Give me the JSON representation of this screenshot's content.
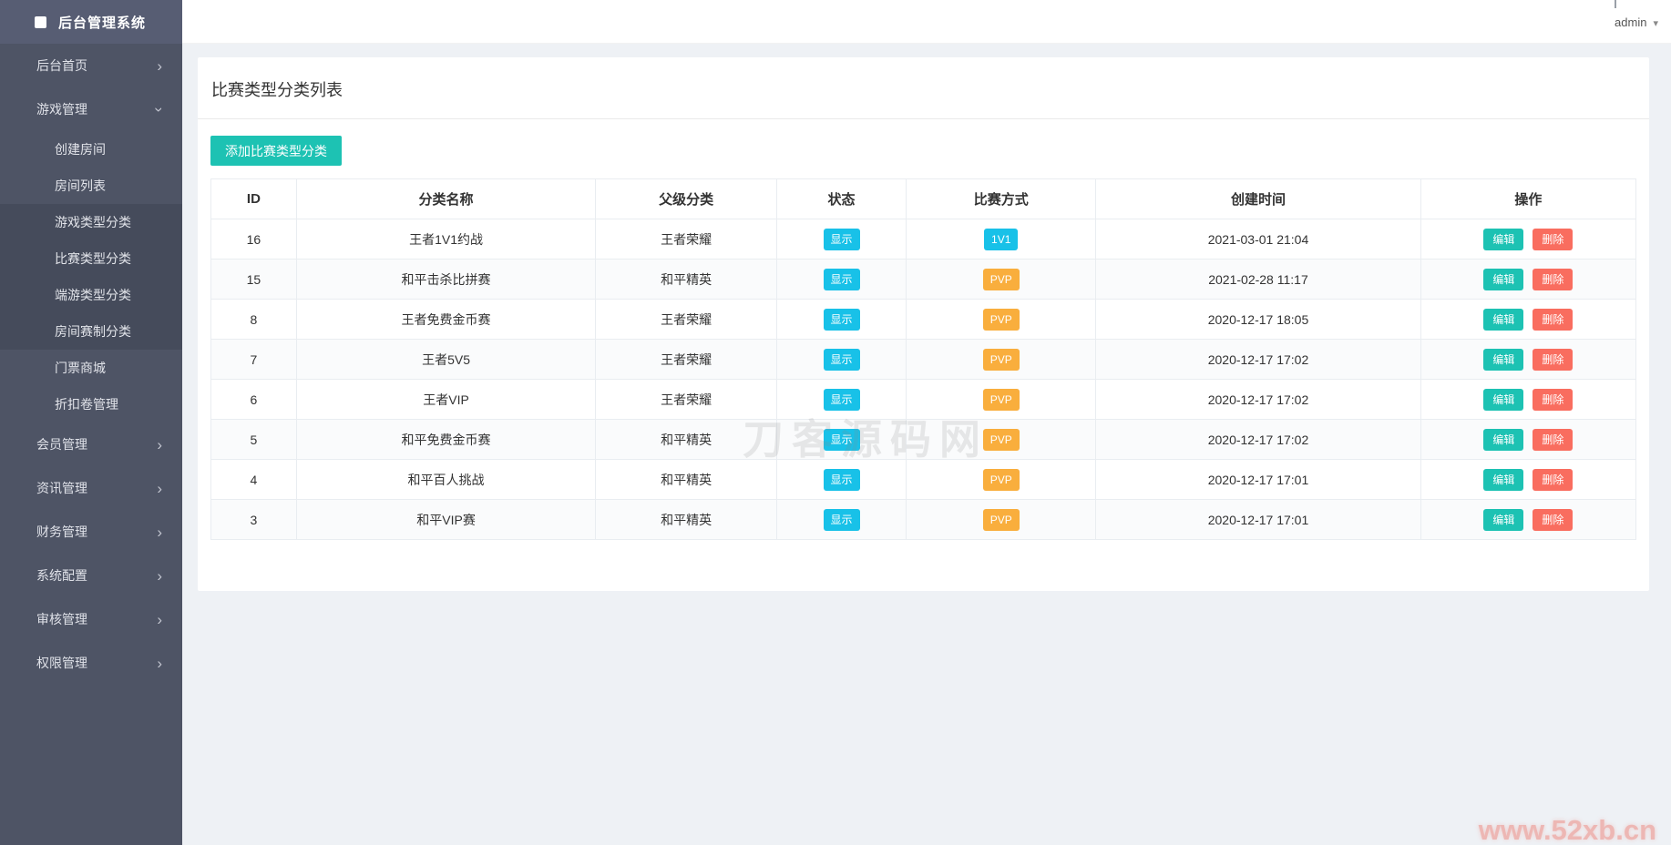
{
  "app": {
    "title": "后台管理系统"
  },
  "topbar": {
    "username": "admin"
  },
  "sidebar": {
    "items": [
      {
        "label": "后台首页"
      },
      {
        "label": "游戏管理",
        "children": [
          {
            "label": "创建房间"
          },
          {
            "label": "房间列表"
          },
          {
            "label": "游戏类型分类"
          },
          {
            "label": "比赛类型分类"
          },
          {
            "label": "端游类型分类"
          },
          {
            "label": "房间赛制分类"
          },
          {
            "label": "门票商城"
          },
          {
            "label": "折扣卷管理"
          }
        ]
      },
      {
        "label": "会员管理"
      },
      {
        "label": "资讯管理"
      },
      {
        "label": "财务管理"
      },
      {
        "label": "系统配置"
      },
      {
        "label": "审核管理"
      },
      {
        "label": "权限管理"
      }
    ]
  },
  "page": {
    "title": "比赛类型分类列表",
    "add_button": "添加比赛类型分类"
  },
  "table": {
    "columns": [
      "ID",
      "分类名称",
      "父级分类",
      "状态",
      "比赛方式",
      "创建时间",
      "操作"
    ],
    "actions": {
      "edit": "编辑",
      "delete": "删除"
    },
    "rows": [
      {
        "id": "16",
        "name": "王者1V1约战",
        "parent": "王者荣耀",
        "status": "显示",
        "mode": "1V1",
        "mode_style": "cyan",
        "time": "2021-03-01 21:04"
      },
      {
        "id": "15",
        "name": "和平击杀比拼赛",
        "parent": "和平精英",
        "status": "显示",
        "mode": "PVP",
        "mode_style": "orange",
        "time": "2021-02-28 11:17"
      },
      {
        "id": "8",
        "name": "王者免费金币赛",
        "parent": "王者荣耀",
        "status": "显示",
        "mode": "PVP",
        "mode_style": "orange",
        "time": "2020-12-17 18:05"
      },
      {
        "id": "7",
        "name": "王者5V5",
        "parent": "王者荣耀",
        "status": "显示",
        "mode": "PVP",
        "mode_style": "orange",
        "time": "2020-12-17 17:02"
      },
      {
        "id": "6",
        "name": "王者VIP",
        "parent": "王者荣耀",
        "status": "显示",
        "mode": "PVP",
        "mode_style": "orange",
        "time": "2020-12-17 17:02"
      },
      {
        "id": "5",
        "name": "和平免费金币赛",
        "parent": "和平精英",
        "status": "显示",
        "mode": "PVP",
        "mode_style": "orange",
        "time": "2020-12-17 17:02"
      },
      {
        "id": "4",
        "name": "和平百人挑战",
        "parent": "和平精英",
        "status": "显示",
        "mode": "PVP",
        "mode_style": "orange",
        "time": "2020-12-17 17:01"
      },
      {
        "id": "3",
        "name": "和平VIP赛",
        "parent": "和平精英",
        "status": "显示",
        "mode": "PVP",
        "mode_style": "orange",
        "time": "2020-12-17 17:01"
      }
    ]
  },
  "watermarks": {
    "center": "刀客源码网",
    "corner": "www.52xb.cn"
  },
  "colors": {
    "sidebar_bg": "#4e5465",
    "sidebar_header_bg": "#575d73",
    "submenu_dark_bg": "#454b5b",
    "content_bg": "#eef1f5",
    "accent_teal": "#1dc2b3",
    "badge_cyan": "#18c1e8",
    "badge_orange": "#f9ae3d",
    "delete_red": "#f96d5f",
    "watermark_pink": "#eda9a4"
  }
}
